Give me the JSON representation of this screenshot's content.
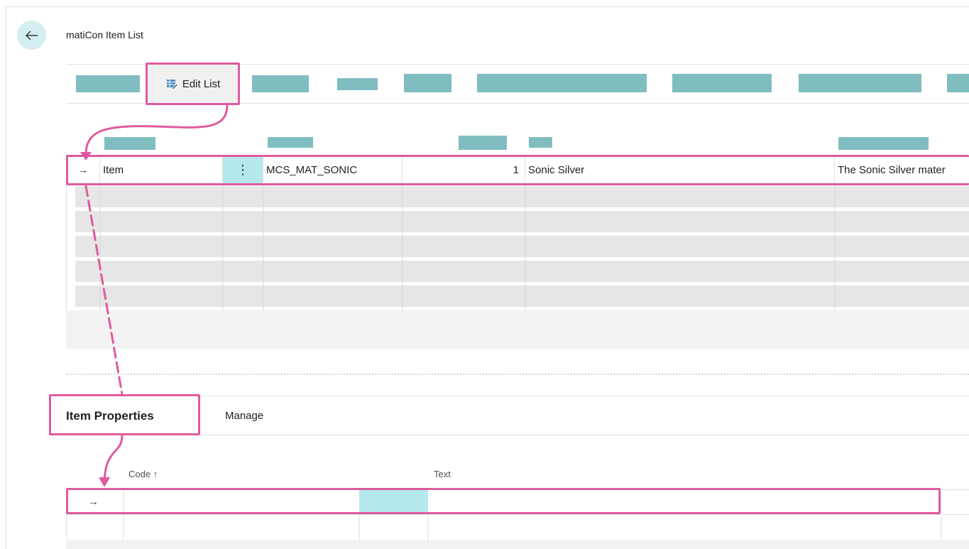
{
  "page": {
    "title": "matiCon Item List"
  },
  "toolbar": {
    "edit_list_label": "Edit List"
  },
  "grid": {
    "selected_row": {
      "arrow": "→",
      "type": "Item",
      "menu": "⋮",
      "code": "MCS_MAT_SONIC",
      "number": "1",
      "name": "Sonic Silver",
      "description": "The Sonic Silver mater"
    },
    "empty_rows": 5
  },
  "part": {
    "tabs": [
      {
        "label": "Item Properties"
      },
      {
        "label": "Manage"
      }
    ],
    "columns": {
      "code": "Code ↑",
      "text": "Text"
    },
    "row_arrow": "→"
  },
  "colors": {
    "accent": "#80bdc1",
    "highlight": "#e05a9e",
    "active_cell": "#b4e8ec"
  }
}
